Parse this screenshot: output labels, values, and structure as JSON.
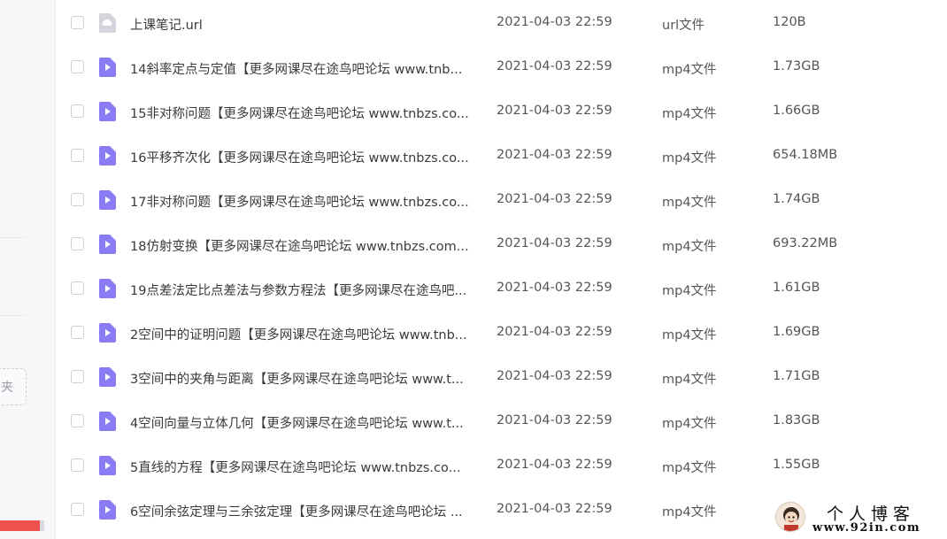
{
  "sidebar": {
    "new_folder_label": "夹",
    "storage_used_fraction": 0.9
  },
  "files": [
    {
      "name": "上课笔记.url",
      "date": "2021-04-03 22:59",
      "type": "url文件",
      "size": "120B",
      "icon": "link-file-icon"
    },
    {
      "name": "14斜率定点与定值【更多网课尽在途鸟吧论坛 www.tnb...",
      "date": "2021-04-03 22:59",
      "type": "mp4文件",
      "size": "1.73GB",
      "icon": "video-file-icon"
    },
    {
      "name": "15非对称问题【更多网课尽在途鸟吧论坛 www.tnbzs.co...",
      "date": "2021-04-03 22:59",
      "type": "mp4文件",
      "size": "1.66GB",
      "icon": "video-file-icon"
    },
    {
      "name": "16平移齐次化【更多网课尽在途鸟吧论坛 www.tnbzs.co...",
      "date": "2021-04-03 22:59",
      "type": "mp4文件",
      "size": "654.18MB",
      "icon": "video-file-icon"
    },
    {
      "name": "17非对称问题【更多网课尽在途鸟吧论坛 www.tnbzs.co...",
      "date": "2021-04-03 22:59",
      "type": "mp4文件",
      "size": "1.74GB",
      "icon": "video-file-icon"
    },
    {
      "name": "18仿射变换【更多网课尽在途鸟吧论坛 www.tnbzs.com...",
      "date": "2021-04-03 22:59",
      "type": "mp4文件",
      "size": "693.22MB",
      "icon": "video-file-icon"
    },
    {
      "name": "19点差法定比点差法与参数方程法【更多网课尽在途鸟吧...",
      "date": "2021-04-03 22:59",
      "type": "mp4文件",
      "size": "1.61GB",
      "icon": "video-file-icon"
    },
    {
      "name": "2空间中的证明问题【更多网课尽在途鸟吧论坛 www.tnb...",
      "date": "2021-04-03 22:59",
      "type": "mp4文件",
      "size": "1.69GB",
      "icon": "video-file-icon"
    },
    {
      "name": "3空间中的夹角与距离【更多网课尽在途鸟吧论坛 www.t...",
      "date": "2021-04-03 22:59",
      "type": "mp4文件",
      "size": "1.71GB",
      "icon": "video-file-icon"
    },
    {
      "name": "4空间向量与立体几何【更多网课尽在途鸟吧论坛 www.t...",
      "date": "2021-04-03 22:59",
      "type": "mp4文件",
      "size": "1.83GB",
      "icon": "video-file-icon"
    },
    {
      "name": "5直线的方程【更多网课尽在途鸟吧论坛 www.tnbzs.co...",
      "date": "2021-04-03 22:59",
      "type": "mp4文件",
      "size": "1.55GB",
      "icon": "video-file-icon"
    },
    {
      "name": "6空间余弦定理与三余弦定理【更多网课尽在途鸟吧论坛 ...",
      "date": "2021-04-03 22:59",
      "type": "mp4文件",
      "size": "",
      "icon": "video-file-icon"
    }
  ],
  "watermark": {
    "title": "个人博客",
    "url": "www.92in.com"
  },
  "colors": {
    "video_icon": "#8b7cf6",
    "link_icon": "#d4d4dc",
    "progress": "#f0504e"
  }
}
